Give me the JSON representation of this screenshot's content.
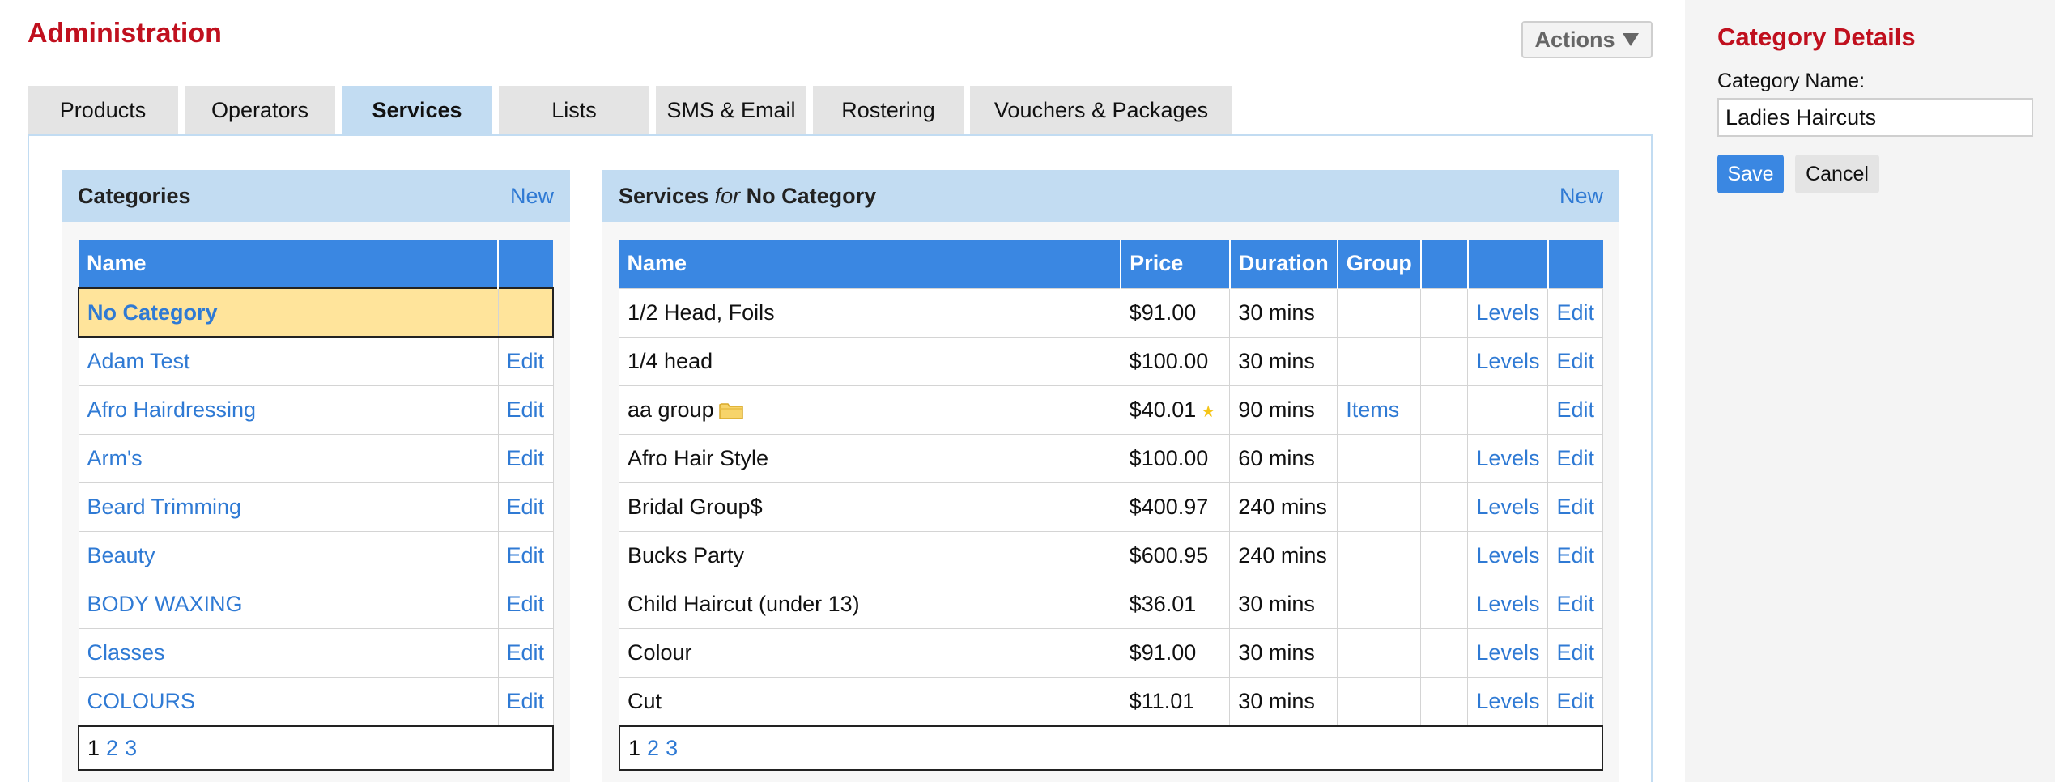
{
  "header": {
    "title": "Administration",
    "actions_label": "Actions",
    "actions_icon": "triangle-down-icon"
  },
  "tabs": [
    {
      "label": "Products"
    },
    {
      "label": "Operators"
    },
    {
      "label": "Services",
      "active": true
    },
    {
      "label": "Lists"
    },
    {
      "label": "SMS & Email"
    },
    {
      "label": "Rostering"
    },
    {
      "label": "Vouchers & Packages"
    }
  ],
  "categories": {
    "title": "Categories",
    "new_label": "New",
    "columns": [
      "Name",
      ""
    ],
    "rows": [
      {
        "name": "No Category",
        "edit": ""
      },
      {
        "name": "Adam Test",
        "edit": "Edit"
      },
      {
        "name": "Afro Hairdressing",
        "edit": "Edit"
      },
      {
        "name": "Arm's",
        "edit": "Edit"
      },
      {
        "name": "Beard Trimming",
        "edit": "Edit"
      },
      {
        "name": "Beauty",
        "edit": "Edit"
      },
      {
        "name": "BODY WAXING",
        "edit": "Edit"
      },
      {
        "name": "Classes",
        "edit": "Edit"
      },
      {
        "name": "COLOURS",
        "edit": "Edit"
      }
    ],
    "pager": {
      "current": "1",
      "pages": [
        "2",
        "3"
      ]
    }
  },
  "services": {
    "title": "Services",
    "for_word": "for",
    "category": "No Category",
    "new_label": "New",
    "columns": [
      "Name",
      "Price",
      "Duration",
      "Group",
      "",
      "",
      ""
    ],
    "rows": [
      {
        "name": "1/2 Head, Foils",
        "price": "$91.00",
        "duration": "30 mins",
        "group": "",
        "levels": "Levels",
        "edit": "Edit"
      },
      {
        "name": "1/4 head",
        "price": "$100.00",
        "duration": "30 mins",
        "group": "",
        "levels": "Levels",
        "edit": "Edit"
      },
      {
        "name": "aa group",
        "price": "$40.01",
        "duration": "90 mins",
        "group": "Items",
        "levels": "",
        "edit": "Edit",
        "folder": true,
        "star": true
      },
      {
        "name": "Afro Hair Style",
        "price": "$100.00",
        "duration": "60 mins",
        "group": "",
        "levels": "Levels",
        "edit": "Edit"
      },
      {
        "name": "Bridal Group$",
        "price": "$400.97",
        "duration": "240 mins",
        "group": "",
        "levels": "Levels",
        "edit": "Edit"
      },
      {
        "name": "Bucks Party",
        "price": "$600.95",
        "duration": "240 mins",
        "group": "",
        "levels": "Levels",
        "edit": "Edit"
      },
      {
        "name": "Child Haircut (under 13)",
        "price": "$36.01",
        "duration": "30 mins",
        "group": "",
        "levels": "Levels",
        "edit": "Edit"
      },
      {
        "name": "Colour",
        "price": "$91.00",
        "duration": "30 mins",
        "group": "",
        "levels": "Levels",
        "edit": "Edit"
      },
      {
        "name": "Cut",
        "price": "$11.01",
        "duration": "30 mins",
        "group": "",
        "levels": "Levels",
        "edit": "Edit"
      }
    ],
    "pager": {
      "current": "1",
      "pages": [
        "2",
        "3"
      ]
    }
  },
  "details": {
    "title": "Category Details",
    "name_label": "Category Name:",
    "name_value": "Ladies Haircuts",
    "save_label": "Save",
    "cancel_label": "Cancel"
  },
  "colors": {
    "brand_red": "#c0101e",
    "header_blue": "#3a87e2",
    "panel_blue": "#c2dcf2",
    "selected_yellow": "#ffe49b",
    "link_blue": "#2f7ad4"
  }
}
